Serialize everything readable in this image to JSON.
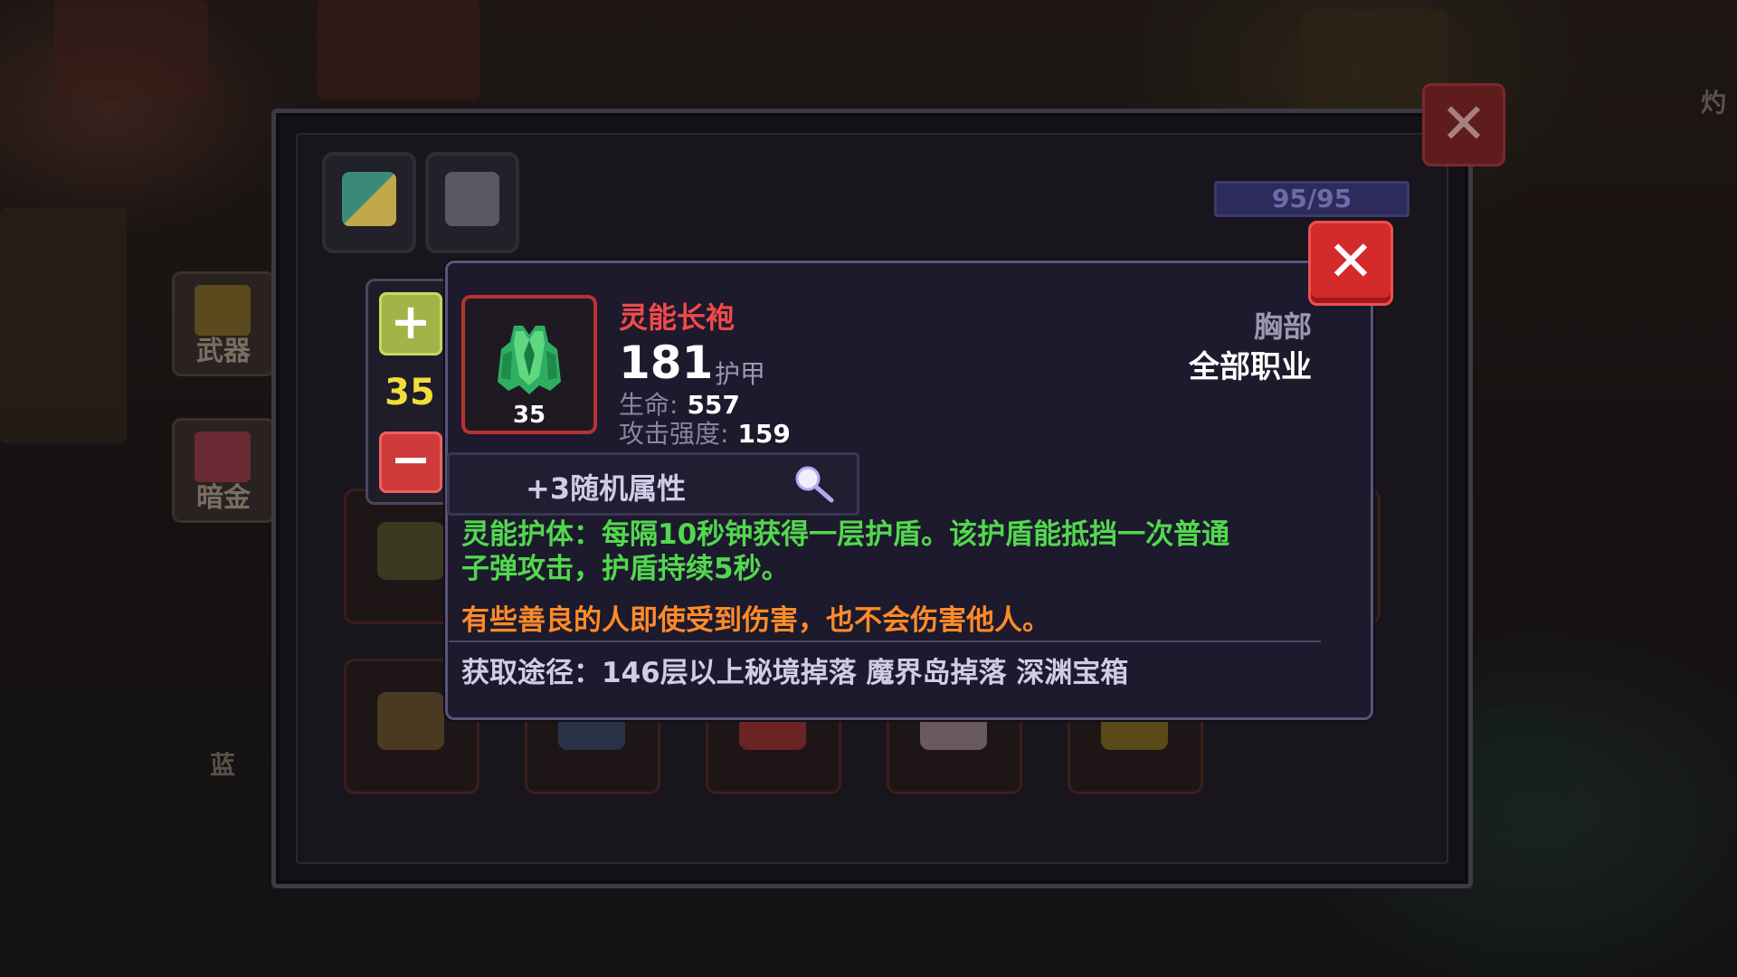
{
  "side_panel": {
    "weapon_label": "武器",
    "dark_gold_label": "暗金",
    "partial_label": "蓝",
    "right_partial_label": "灼"
  },
  "inventory": {
    "capacity_text": "95/95",
    "close_label": "✕"
  },
  "quantity": {
    "plus_label": "+",
    "value": "35",
    "minus_label": "−"
  },
  "tooltip": {
    "close_label": "✕",
    "item_name": "灵能长袍",
    "item_level": "35",
    "armor_value": "181",
    "armor_label": "护甲",
    "stats": [
      {
        "label": "生命:",
        "value": "557"
      },
      {
        "label": "攻击强度:",
        "value": "159"
      }
    ],
    "slot_type": "胸部",
    "class_type": "全部职业",
    "random_attr": "+3随机属性",
    "skill_line1": "灵能护体：每隔10秒钟获得一层护盾。该护盾能抵挡一次普通",
    "skill_line2": "子弹攻击，护盾持续5秒。",
    "flavor": "有些善良的人即使受到伤害，也不会伤害他人。",
    "source": "获取途径：146层以上秘境掉落 魔界岛掉落 深渊宝箱"
  },
  "colors": {
    "item_name": "#f04a4a",
    "skill_text": "#52d84e",
    "flavor_text": "#ff8a2a",
    "quantity_value": "#f2de3a",
    "close_button": "#d42a2a"
  },
  "icons": [
    "plus-icon",
    "minus-icon",
    "close-icon",
    "armor-robe-icon",
    "magnifier-icon",
    "bag-icon",
    "helmet-icon"
  ]
}
